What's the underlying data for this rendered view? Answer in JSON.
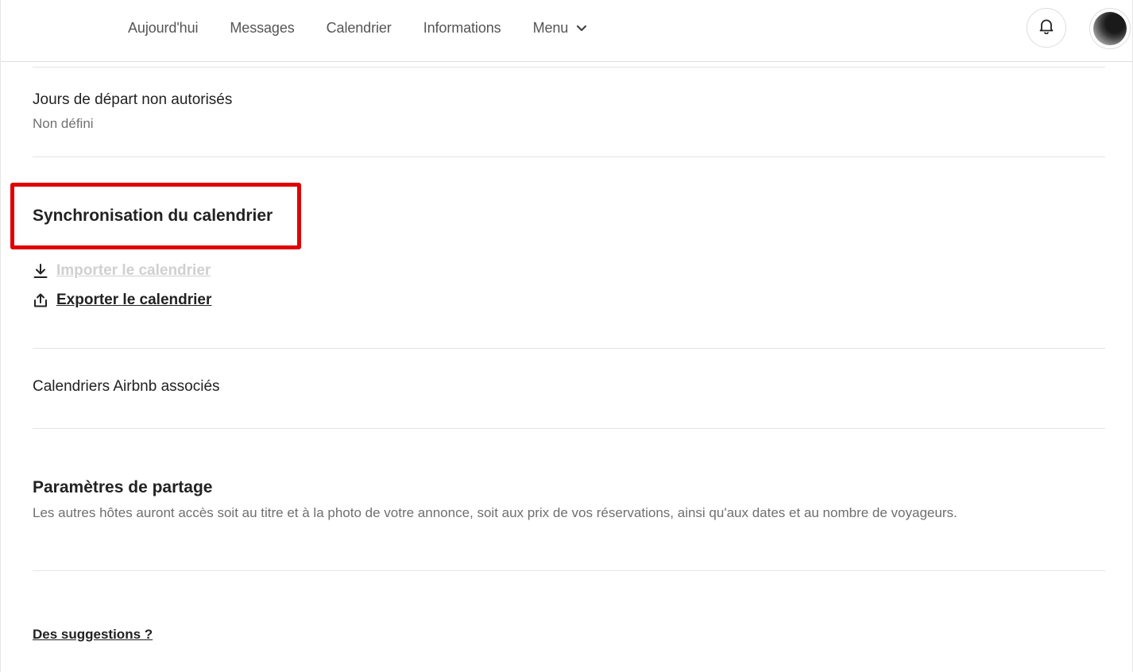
{
  "header": {
    "nav": [
      "Aujourd'hui",
      "Messages",
      "Calendrier",
      "Informations",
      "Menu"
    ]
  },
  "departure_days": {
    "title": "Jours de départ non autorisés",
    "value": "Non défini"
  },
  "calendar_sync": {
    "title": "Synchronisation du calendrier",
    "import_label": "Importer le calendrier",
    "export_label": "Exporter le calendrier"
  },
  "linked_calendars": {
    "title": "Calendriers Airbnb associés"
  },
  "sharing": {
    "title": "Paramètres de partage",
    "description": "Les autres hôtes auront accès soit au titre et à la photo de votre annonce, soit aux prix de vos réservations, ainsi qu'aux dates et au nombre de voyageurs."
  },
  "footer": {
    "suggestions_label": "Des suggestions ?"
  },
  "colors": {
    "highlight": "#e00000",
    "disabled_link": "#d0d0d0",
    "text": "#222222",
    "muted": "#717171"
  }
}
